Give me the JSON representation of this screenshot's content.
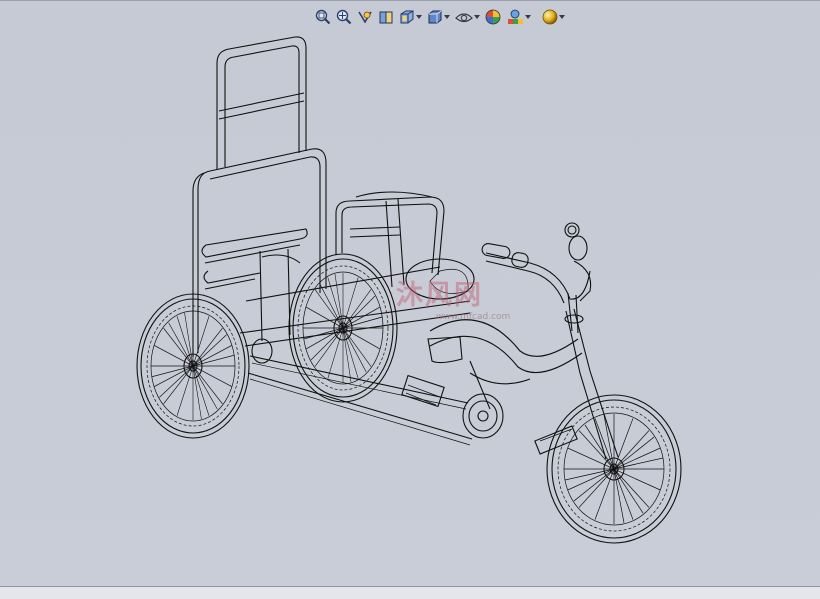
{
  "viewport": {
    "background": "#c8ccd6"
  },
  "toolbar": {
    "buttons": [
      {
        "name": "zoom-to-fit",
        "icon": "zoom-to-fit-icon"
      },
      {
        "name": "zoom-to-area",
        "icon": "zoom-to-area-icon"
      },
      {
        "name": "previous-view",
        "icon": "previous-view-icon"
      },
      {
        "name": "section-view",
        "icon": "section-view-icon"
      },
      {
        "name": "view-orientation",
        "icon": "view-orientation-icon",
        "dropdown": true
      },
      {
        "name": "display-style",
        "icon": "display-style-icon",
        "dropdown": true
      },
      {
        "name": "hide-show-items",
        "icon": "hide-show-items-icon",
        "dropdown": true
      },
      {
        "name": "edit-appearance",
        "icon": "appearance-icon"
      },
      {
        "name": "apply-scene",
        "icon": "scene-icon",
        "dropdown": true
      },
      {
        "name": "view-settings",
        "icon": "view-settings-icon",
        "dropdown": true
      }
    ]
  },
  "model": {
    "description": "wireframe tricycle"
  },
  "watermark": {
    "text": "沐风网",
    "url": "www.mfcad.com"
  }
}
